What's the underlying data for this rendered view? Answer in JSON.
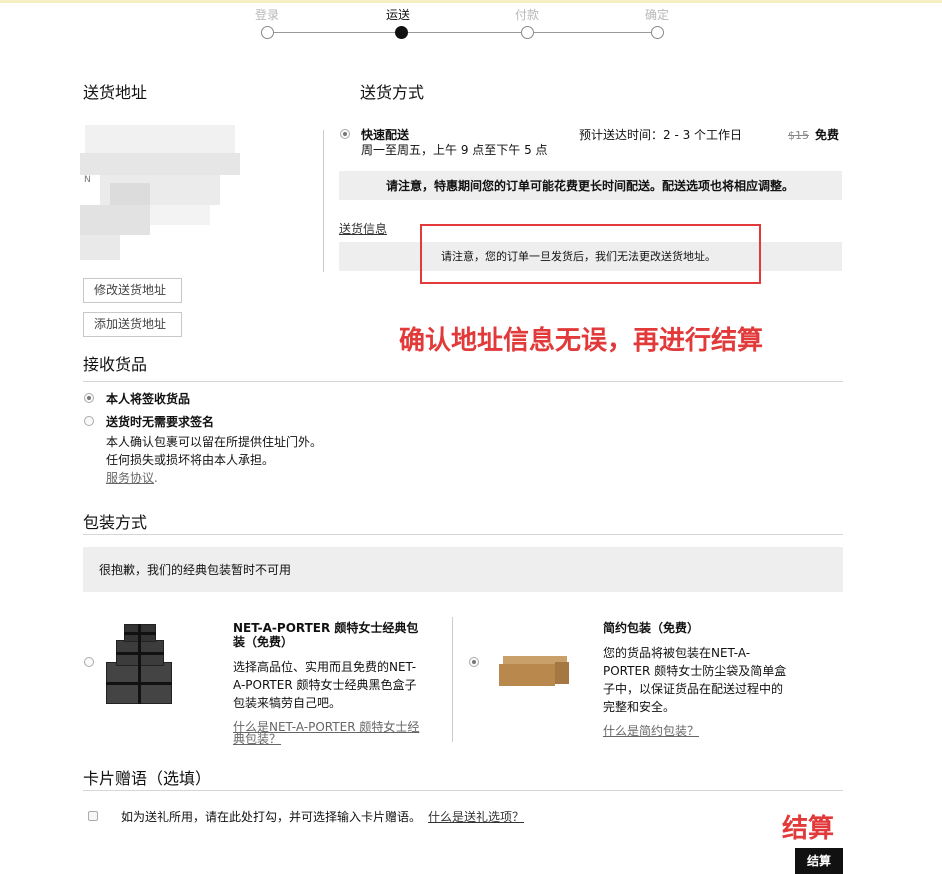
{
  "stepper": {
    "steps": [
      {
        "label": "登录",
        "active": false
      },
      {
        "label": "运送",
        "active": true
      },
      {
        "label": "付款",
        "active": false
      },
      {
        "label": "确定",
        "active": false
      }
    ]
  },
  "address": {
    "title": "送货地址",
    "blurred_text": "N",
    "edit_button": "修改送货地址",
    "add_button": "添加送货地址"
  },
  "shipping": {
    "title": "送货方式",
    "option_name": "快速配送",
    "option_hours": "周一至周五，上午 9 点至下午 5 点",
    "estimate": "预计送达时间：2 - 3 个工作日",
    "old_price": "$15",
    "price": "免费",
    "holiday_notice": "请注意，特惠期间您的订单可能花费更长时间配送。配送选项也将相应调整。",
    "info_link": "送货信息",
    "address_notice": "请注意，您的订单一旦发货后，我们无法更改送货地址。"
  },
  "annotations": {
    "confirm_text": "确认地址信息无误，再进行结算",
    "checkout_text": "结算"
  },
  "receive": {
    "title": "接收货品",
    "option1": "本人将签收货品",
    "option2": "送货时无需要求签名",
    "option2_desc1": "本人确认包裹可以留在所提供住址门外。",
    "option2_desc2": "任何损失或损坏将由本人承担。",
    "terms_link": "服务协议",
    "terms_period": "."
  },
  "packaging": {
    "title": "包装方式",
    "unavailable_notice": "很抱歉，我们的经典包装暂时不可用",
    "option1": {
      "title_line1": "NET-A-PORTER 颇特女士经典包",
      "title_line2": "装（免费）",
      "desc_lines": [
        "选择高品位、实用而且免费的NET-",
        "A-PORTER 颇特女士经典黑色盒子",
        "包装来犒劳自己吧。"
      ],
      "link_line1": "什么是NET-A-PORTER 颇特女士经",
      "link_line2": "典包装？"
    },
    "option2": {
      "title": "简约包装（免费）",
      "desc_lines": [
        "您的货品将被包装在NET-A-",
        "PORTER 颇特女士防尘袋及简单盒",
        "子中，以保证货品在配送过程中的",
        "完整和安全。"
      ],
      "link": "什么是简约包装？"
    }
  },
  "card": {
    "title": "卡片赠语（选填）",
    "checkbox_label": "如为送礼所用，请在此处打勾，并可选择输入卡片赠语。",
    "link": "什么是送礼选项？"
  },
  "checkout": {
    "button_label": "结算"
  },
  "colors": {
    "annotation_red": "#e23a3a",
    "grey_panel": "#eeeeee",
    "checkout_bg": "#111111"
  }
}
